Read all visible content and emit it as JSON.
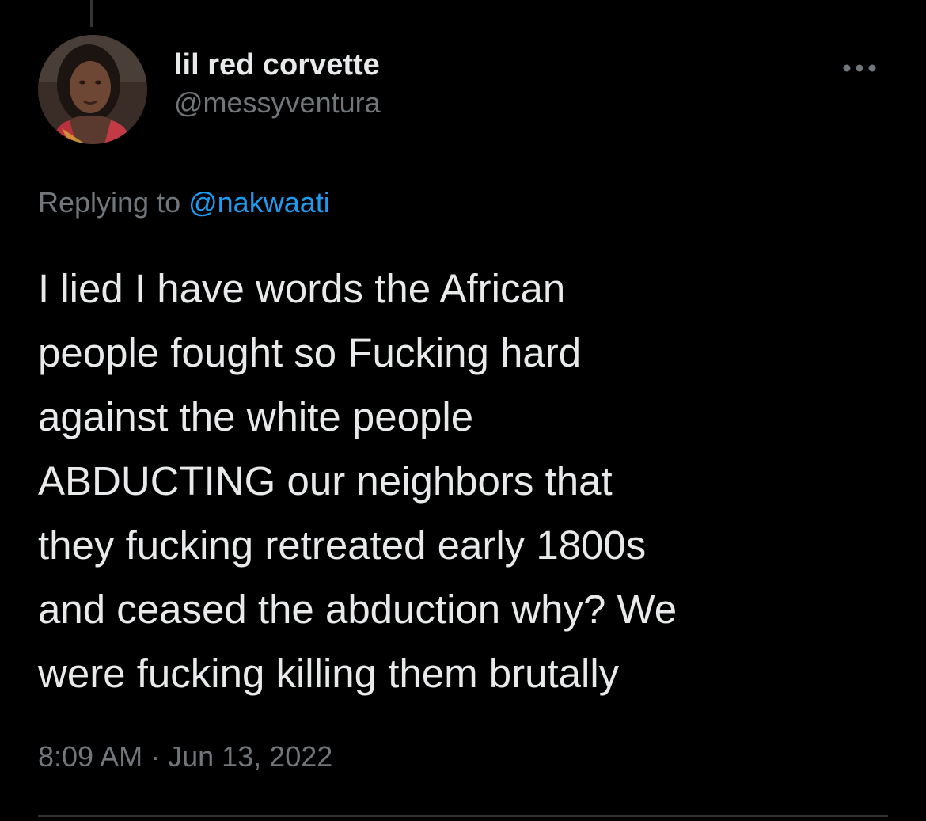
{
  "user": {
    "display_name": "lil red corvette",
    "handle": "@messyventura",
    "avatar_icon": "profile-photo"
  },
  "header": {
    "more_icon": "more-horizontal-icon"
  },
  "reply": {
    "prefix": "Replying to ",
    "mention": "@nakwaati"
  },
  "tweet": {
    "text": "I lied I have words the African\npeople fought so Fucking hard\nagainst the white people\nABDUCTING our neighbors that\nthey fucking retreated early 1800s\nand ceased the abduction why? We\nwere fucking killing them brutally"
  },
  "meta": {
    "time": "8:09 AM",
    "separator": " · ",
    "date": "Jun 13, 2022"
  },
  "colors": {
    "background": "#000000",
    "primary_text": "#e7e9ea",
    "secondary_text": "#71767b",
    "link": "#1d9bf0",
    "divider": "#2f3336"
  }
}
